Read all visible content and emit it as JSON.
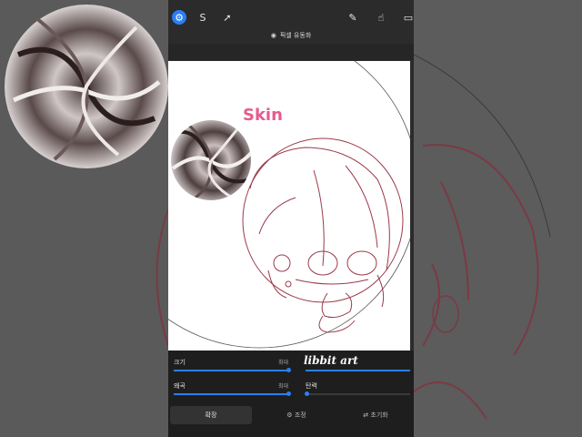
{
  "toolbar": {
    "tools": [
      {
        "name": "adjust-tool",
        "glyph": "⚙"
      },
      {
        "name": "selection-tool",
        "glyph": "S"
      },
      {
        "name": "transform-tool",
        "glyph": "➚"
      },
      {
        "name": "brush-tool",
        "glyph": "✎"
      },
      {
        "name": "smudge-tool",
        "glyph": "☝"
      },
      {
        "name": "eraser-tool",
        "glyph": "▭"
      }
    ]
  },
  "title": {
    "icon": "◉",
    "label": "픽셀 유동화"
  },
  "canvas": {
    "heading": "Skin"
  },
  "panel": {
    "size_label": "크기",
    "size_max": "최대",
    "distortion_label": "왜곡",
    "distortion_max": "최대",
    "elasticity_label": "탄력",
    "size_value": 0.95,
    "distortion_value": 0.95,
    "elasticity_value": 0.0
  },
  "tabs": {
    "expand": "확장",
    "adjust": "조정",
    "reset": "초기화"
  },
  "watermark": "libbit art",
  "colors": {
    "accent": "#2a7ef4",
    "heading": "#e65b8e",
    "line": "#9a3a4a"
  }
}
